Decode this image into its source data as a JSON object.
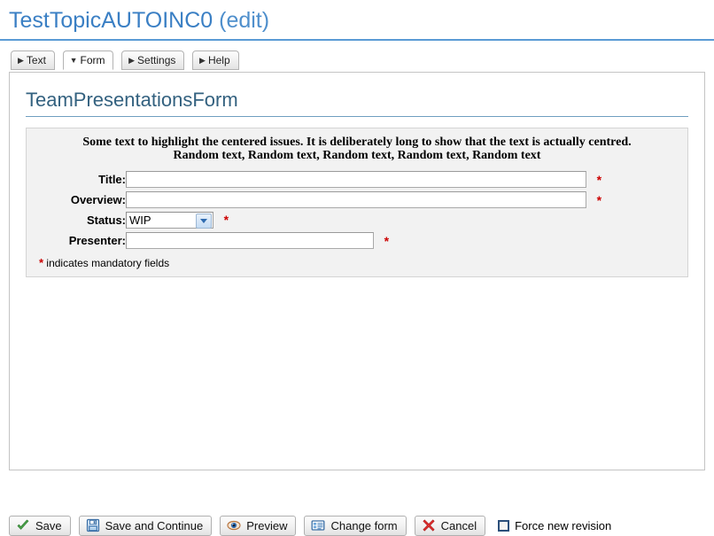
{
  "page": {
    "title_main": "TestTopicAUTOINC0",
    "title_suffix": " (edit)"
  },
  "tabs": [
    {
      "label": "Text",
      "marker": "▶",
      "active": false,
      "name": "tab-text"
    },
    {
      "label": "Form",
      "marker": "▼",
      "active": true,
      "name": "tab-form"
    },
    {
      "label": "Settings",
      "marker": "▶",
      "active": false,
      "name": "tab-settings"
    },
    {
      "label": "Help",
      "marker": "▶",
      "active": false,
      "name": "tab-help"
    }
  ],
  "form": {
    "heading": "TeamPresentationsForm",
    "blurb_line1": "Some text to highlight the centered issues. It is deliberately long to show that the text is actually centred.",
    "blurb_line2": "Random text, Random text, Random text, Random text, Random text",
    "fields": {
      "title": {
        "label": "Title:",
        "value": "",
        "placeholder": "",
        "required_marker": "*"
      },
      "overview": {
        "label": "Overview:",
        "value": "",
        "placeholder": "",
        "required_marker": "*"
      },
      "status": {
        "label": "Status:",
        "selected": "WIP",
        "options": [
          "WIP"
        ],
        "required_marker": "*"
      },
      "presenter": {
        "label": "Presenter:",
        "value": "",
        "placeholder": "",
        "required_marker": "*"
      }
    },
    "mandatory_star": "*",
    "mandatory_note": " indicates mandatory fields"
  },
  "buttons": {
    "save": {
      "label": "Save",
      "icon": "green-check-icon"
    },
    "save_continue": {
      "label": "Save and Continue",
      "icon": "floppy-disk-icon"
    },
    "preview": {
      "label": "Preview",
      "icon": "eye-icon"
    },
    "change_form": {
      "label": "Change form",
      "icon": "form-list-icon"
    },
    "cancel": {
      "label": "Cancel",
      "icon": "red-x-icon"
    },
    "force_new_revision": {
      "label": "Force new revision",
      "checked": false
    }
  },
  "colors": {
    "title_blue": "#3a7fc4",
    "title_rule": "#5a9bd5",
    "form_heading": "#33617f",
    "required_red": "#cc0000",
    "panel_border": "#c4c4c4",
    "formbox_bg": "#f2f2f2"
  }
}
